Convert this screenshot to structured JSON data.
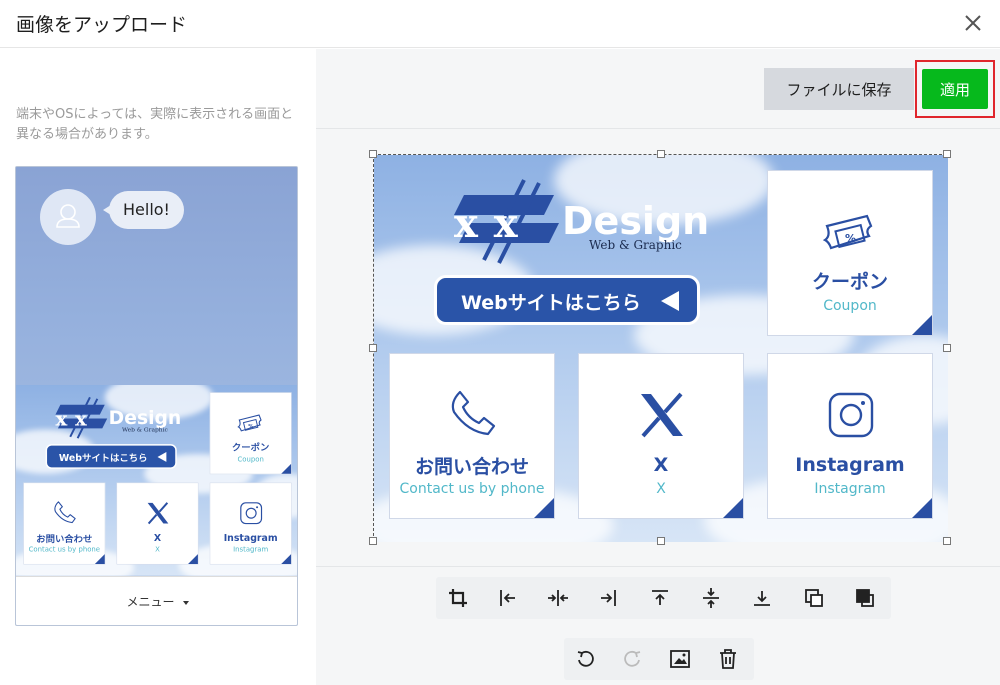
{
  "dialog": {
    "title": "画像をアップロード"
  },
  "preview": {
    "note": "端末やOSによっては、実際に表示される画面と異なる場合があります。",
    "chat_message": "Hello!",
    "menu_bar_label": "メニュー"
  },
  "toolbar": {
    "save_label": "ファイルに保存",
    "apply_label": "適用"
  },
  "rich_menu": {
    "logo_text": "x   x",
    "logo_brand": "Design",
    "logo_tagline": "Web & Graphic",
    "website_button": "Webサイトはこちら",
    "tiles": [
      {
        "title": "クーポン",
        "subtitle": "Coupon",
        "icon": "coupon-ticket-icon"
      },
      {
        "title": "お問い合わせ",
        "subtitle": "Contact us by phone",
        "icon": "phone-icon"
      },
      {
        "title": "X",
        "subtitle": "X",
        "icon": "x-logo-icon"
      },
      {
        "title": "Instagram",
        "subtitle": "Instagram",
        "icon": "instagram-icon"
      }
    ]
  },
  "tools": {
    "row1": [
      "crop-icon",
      "align-left-icon",
      "align-center-horizontal-icon",
      "align-right-icon",
      "align-top-icon",
      "align-center-vertical-icon",
      "align-bottom-icon",
      "bring-forward-icon",
      "send-backward-icon"
    ],
    "row2": [
      "undo-icon",
      "redo-icon",
      "replace-image-icon",
      "delete-icon"
    ]
  },
  "colors": {
    "apply_green": "#06b91c",
    "highlight_red": "#e0262d",
    "brand_blue": "#2a4fa3",
    "subtitle_teal": "#52b8c9"
  }
}
